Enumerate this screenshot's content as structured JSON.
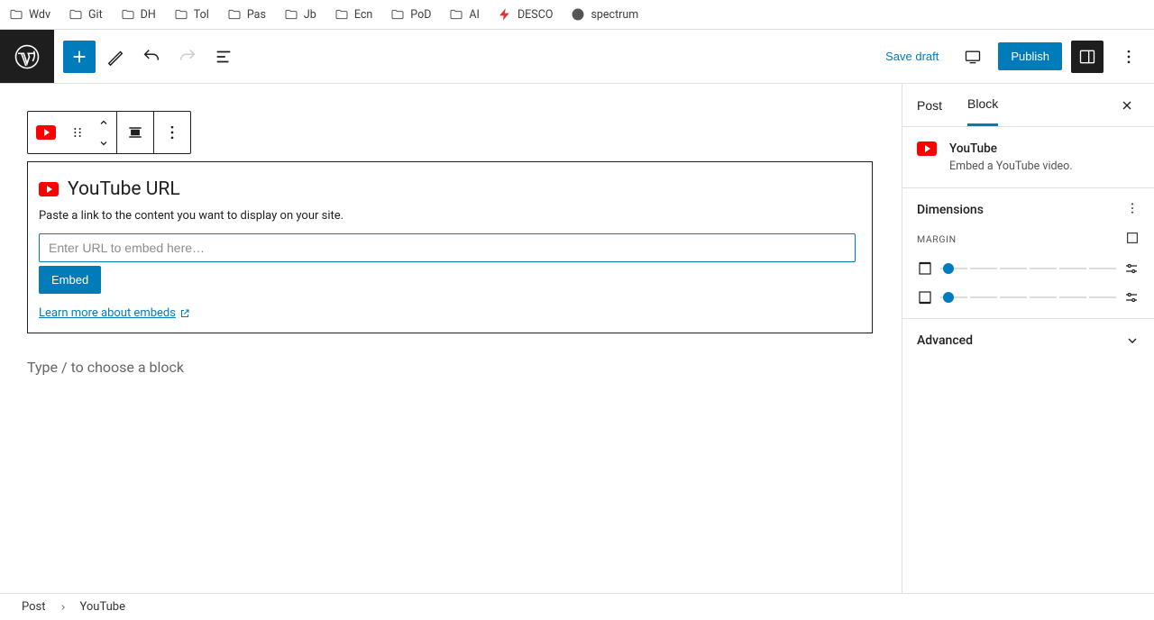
{
  "bookmarks": {
    "b0": "Wdv",
    "b1": "Git",
    "b2": "DH",
    "b3": "Tol",
    "b4": "Pas",
    "b5": "Jb",
    "b6": "Ecn",
    "b7": "PoD",
    "b8": "AI",
    "b9": "DESCO",
    "b10": "spectrum"
  },
  "toolbar": {
    "save_draft": "Save draft",
    "publish": "Publish"
  },
  "block_toolbar": {},
  "youtube_block": {
    "title": "YouTube URL",
    "description": "Paste a link to the content you want to display on your site.",
    "input_value": "",
    "input_placeholder": "Enter URL to embed here…",
    "embed_label": "Embed",
    "learn_more": "Learn more about embeds"
  },
  "canvas_placeholder": "Type / to choose a block",
  "sidebar": {
    "tab_post": "Post",
    "tab_block": "Block",
    "block_name": "YouTube",
    "block_desc": "Embed a YouTube video.",
    "dimensions_title": "Dimensions",
    "margin_label": "MARGIN",
    "advanced_title": "Advanced"
  },
  "breadcrumb": {
    "root": "Post",
    "leaf": "YouTube"
  }
}
